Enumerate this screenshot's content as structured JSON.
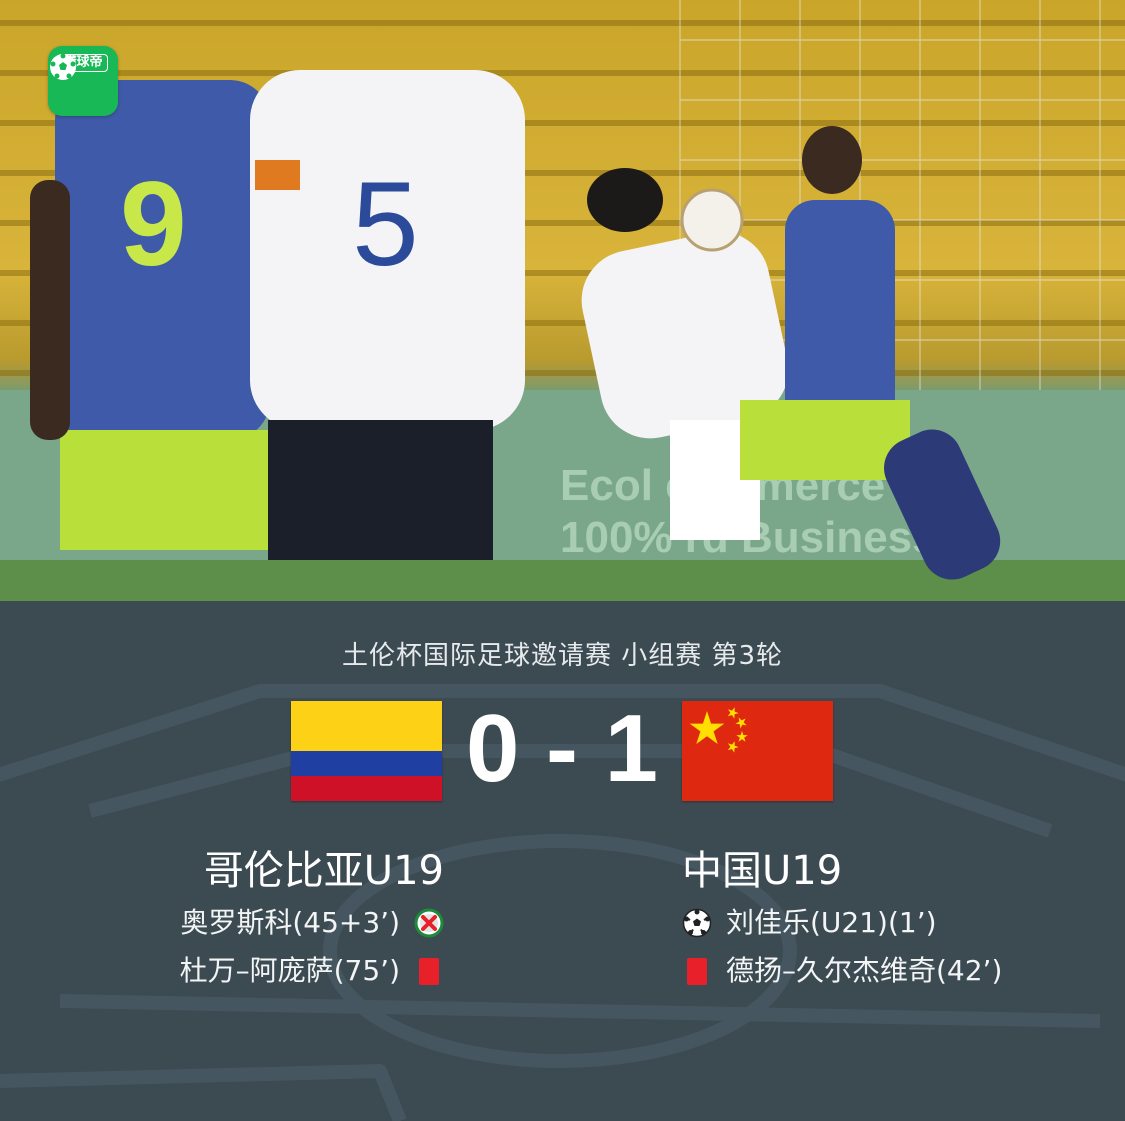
{
  "app": {
    "logo_text": "懂球帝",
    "brand_color": "#19b857"
  },
  "match": {
    "competition": "土伦杯国际足球邀请赛 小组赛 第3轮",
    "score": "0 - 1",
    "home": {
      "name": "哥伦比亚U19",
      "flag": "colombia-flag-icon",
      "events": [
        {
          "text": "奥罗斯科(45+3’)",
          "icon": "missed-penalty-icon"
        },
        {
          "text": "杜万–阿庞萨(75’)",
          "icon": "red-card-icon"
        }
      ]
    },
    "away": {
      "name": "中国U19",
      "flag": "china-flag-icon",
      "events": [
        {
          "text": "刘佳乐(U21)(1’)",
          "icon": "goal-ball-icon"
        },
        {
          "text": "德扬–久尔杰维奇(42’)",
          "icon": "red-card-icon"
        }
      ]
    }
  },
  "photo": {
    "shirt_numbers": [
      "9",
      "5"
    ]
  },
  "colors": {
    "panel_bg": "#3c4a52",
    "red_card": "#e8202a"
  }
}
